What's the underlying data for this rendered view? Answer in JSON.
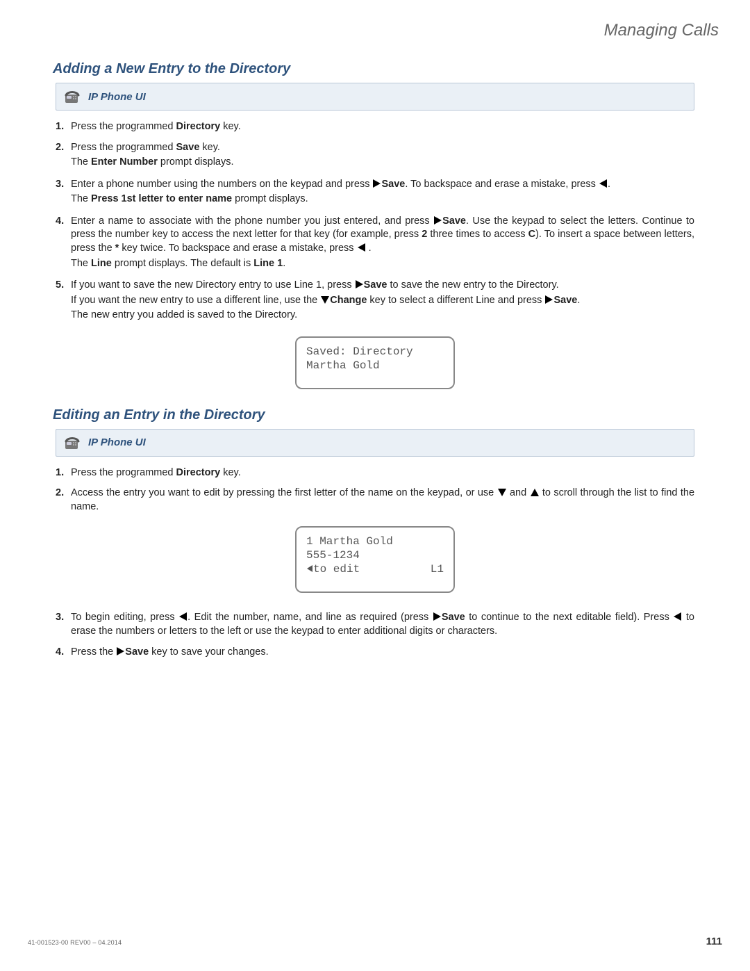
{
  "chapter": "Managing Calls",
  "section1": {
    "heading": "Adding a New Entry to the Directory",
    "banner": "IP Phone UI",
    "steps": {
      "s1": {
        "num": "1.",
        "t1a": "Press the programmed ",
        "t1b": "Directory",
        "t1c": " key."
      },
      "s2": {
        "num": "2.",
        "t1a": "Press the programmed ",
        "t1b": "Save",
        "t1c": " key.",
        "t2a": "The ",
        "t2b": "Enter Number",
        "t2c": " prompt displays."
      },
      "s3": {
        "num": "3.",
        "t1a": "Enter a phone number using the numbers on the keypad and press ",
        "t1b": "Save",
        "t1c": ". To backspace and erase a mistake, press ",
        "t1d": ".",
        "t2a": "The ",
        "t2b": "Press 1st letter to enter name",
        "t2c": " prompt displays."
      },
      "s4": {
        "num": "4.",
        "t1a": "Enter a name to associate with the phone number you just entered, and press ",
        "t1b": "Save",
        "t1c": ". Use the keypad to select the letters. Continue to press the number key to access the next letter for that key (for example, press ",
        "t1d": "2",
        "t1e": " three times to access ",
        "t1f": "C",
        "t1g": "). To insert a space between letters, press the ",
        "t1h": "*",
        "t1i": " key twice. To backspace and erase a mistake, press ",
        "t1j": " .",
        "t2a": "The ",
        "t2b": "Line",
        "t2c": " prompt displays. The default is ",
        "t2d": "Line 1",
        "t2e": "."
      },
      "s5": {
        "num": "5.",
        "t1a": "If you want to save the new Directory entry to use Line 1, press ",
        "t1b": "Save",
        "t1c": " to save the new entry to the Directory.",
        "t2a": "If you want the new entry to use a different line, use the ",
        "t2b": "Change",
        "t2c": " key to select a different Line and press ",
        "t2d": "Save",
        "t2e": ".",
        "t3": "The new entry you added is saved to the Directory."
      }
    },
    "lcd": {
      "l1": "Saved: Directory",
      "l2": "Martha Gold"
    }
  },
  "section2": {
    "heading": "Editing an Entry in the Directory",
    "banner": "IP Phone UI",
    "steps": {
      "s1": {
        "num": "1.",
        "t1a": "Press the programmed ",
        "t1b": "Directory",
        "t1c": " key."
      },
      "s2": {
        "num": "2.",
        "t1a": "Access the entry you want to edit by pressing the first letter of the name on the keypad, or use ",
        "t1b": " and ",
        "t1c": " to scroll through the list to find the name."
      },
      "s3": {
        "num": "3.",
        "t1a": "To begin editing, press ",
        "t1b": ". Edit the number, name, and line as required (press ",
        "t1c": "Save",
        "t1d": " to continue to the next editable field). Press ",
        "t1e": " to erase the numbers or letters to the left or use the keypad to enter additional digits or characters."
      },
      "s4": {
        "num": "4.",
        "t1a": "Press the ",
        "t1b": "Save",
        "t1c": " key to save your changes."
      }
    },
    "lcd": {
      "l1": "1 Martha Gold",
      "l2": "555-1234",
      "l3a": "to edit",
      "l3b": "L1"
    }
  },
  "footer": {
    "docnum": "41-001523-00 REV00 – 04.2014",
    "pagenum": "111"
  }
}
